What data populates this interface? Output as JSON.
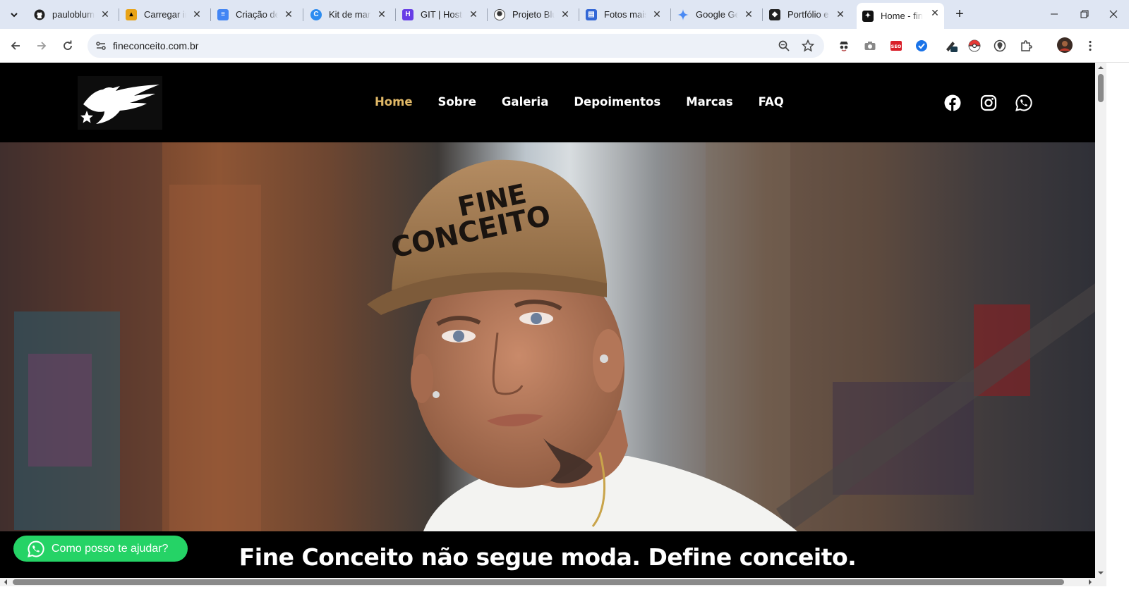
{
  "browser": {
    "tabs": [
      {
        "title": "pauloblum",
        "favicon": "github-icon",
        "color": "#1f1f1f"
      },
      {
        "title": "Carregar in",
        "favicon": "upload-icon",
        "color": "#e8a317"
      },
      {
        "title": "Criação de",
        "favicon": "google-docs-icon",
        "color": "#4285f4"
      },
      {
        "title": "Kit de mar",
        "favicon": "canva-icon",
        "color": "#2d8cf0"
      },
      {
        "title": "GIT | Hostin",
        "favicon": "hostinger-icon",
        "color": "#673de6"
      },
      {
        "title": "Projeto Blu",
        "favicon": "chatgpt-icon",
        "color": "#444444"
      },
      {
        "title": "Fotos mais",
        "favicon": "google-forms-icon",
        "color": "#3367d6"
      },
      {
        "title": "Google Ge",
        "favicon": "gemini-icon",
        "color": "#4a8af4"
      },
      {
        "title": "Portfólio e",
        "favicon": "portfolio-icon",
        "color": "#222222"
      },
      {
        "title": "Home - fin",
        "favicon": "fineconceito-icon",
        "color": "#111111",
        "active": true
      }
    ],
    "url": "fineconceito.com.br"
  },
  "site": {
    "logo_alt": "Fine Conceito logo",
    "nav": [
      {
        "label": "Home",
        "active": true
      },
      {
        "label": "Sobre"
      },
      {
        "label": "Galeria"
      },
      {
        "label": "Depoimentos"
      },
      {
        "label": "Marcas"
      },
      {
        "label": "FAQ"
      }
    ],
    "social": [
      "facebook-icon",
      "instagram-icon",
      "whatsapp-icon"
    ],
    "hero": {
      "cap_text_line1": "FINE",
      "cap_text_line2": "CONCEITO",
      "tagline": "Fine Conceito não segue moda. Define conceito."
    },
    "whatsapp_button": "Como posso te ajudar?",
    "accent_color": "#e0b867",
    "whatsapp_color": "#25d366"
  }
}
